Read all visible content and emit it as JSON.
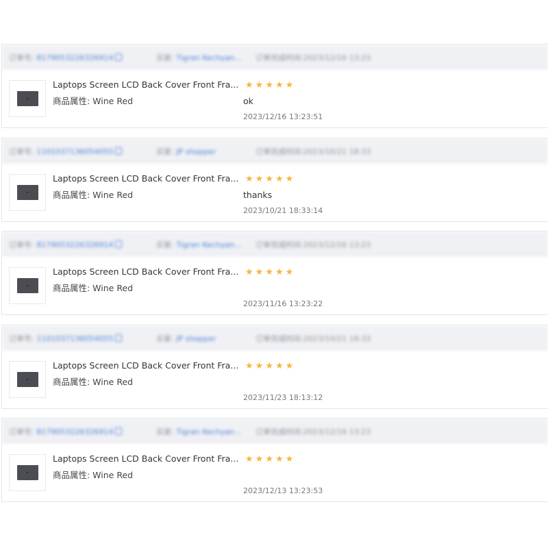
{
  "reviews": [
    {
      "header": {
        "order_label": "订单号:",
        "order_id": "8179053226326914",
        "seller_label": "买家:",
        "seller": "Tigran Kechyan...",
        "time_label": "订单完成时间:",
        "time": "2023/12/16 13:23"
      },
      "product_title": "Laptops Screen LCD Back Cover Front Fra...",
      "attribute": "商品属性: Wine Red",
      "rating": 5,
      "comment": "ok",
      "date": "2023/12/16 13:23:51"
    },
    {
      "header": {
        "order_label": "订单号:",
        "order_id": "1101037136054055",
        "seller_label": "买家:",
        "seller": "JP shopper",
        "time_label": "订单完成时间:",
        "time": "2023/10/21 18:33"
      },
      "product_title": "Laptops Screen LCD Back Cover Front Fra...",
      "attribute": "商品属性: Wine Red",
      "rating": 5,
      "comment": "thanks",
      "date": "2023/10/21 18:33:14"
    },
    {
      "header": {
        "order_label": "订单号:",
        "order_id": "8179053226326914",
        "seller_label": "买家:",
        "seller": "Tigran Kechyan...",
        "time_label": "订单完成时间:",
        "time": "2023/12/16 13:23"
      },
      "product_title": "Laptops Screen LCD Back Cover Front Fra...",
      "attribute": "商品属性: Wine Red",
      "rating": 5,
      "comment": "",
      "date": "2023/11/16 13:23:22"
    },
    {
      "header": {
        "order_label": "订单号:",
        "order_id": "1101037136054055",
        "seller_label": "买家:",
        "seller": "JP shopper",
        "time_label": "订单完成时间:",
        "time": "2023/10/21 18:33"
      },
      "product_title": "Laptops Screen LCD Back Cover Front Fra...",
      "attribute": "商品属性: Wine Red",
      "rating": 5,
      "comment": "",
      "date": "2023/11/23 18:13:12"
    },
    {
      "header": {
        "order_label": "订单号:",
        "order_id": "8179053226326914",
        "seller_label": "买家:",
        "seller": "Tigran Kechyan...",
        "time_label": "订单完成时间:",
        "time": "2023/12/16 13:23"
      },
      "product_title": "Laptops Screen LCD Back Cover Front Fra...",
      "attribute": "商品属性: Wine Red",
      "rating": 5,
      "comment": "",
      "date": "2023/12/13 13:23:53"
    }
  ],
  "icons": {
    "star": "star-icon",
    "copy": "copy-icon",
    "thumbnail": "laptop-screen-thumbnail"
  },
  "colors": {
    "star": "#f5b63c",
    "link": "#4a7fd6",
    "header_bg": "#f0f1f4"
  }
}
